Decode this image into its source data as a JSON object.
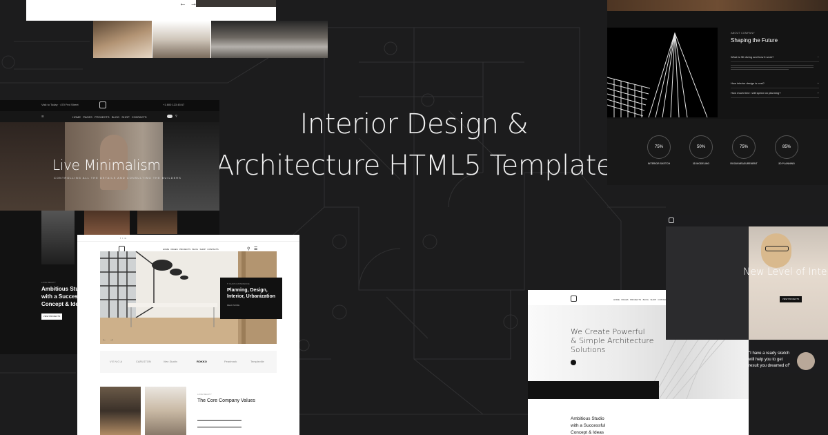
{
  "hero": {
    "line1": "Interior Design &",
    "line2": "Architecture HTML5 Template"
  },
  "left_template": {
    "hero_title": "Live Minimalism",
    "hero_subtitle": "CONTROLLING ALL THE DETAILS AND CONSULTING THE BUILDERS",
    "studio_label": "LOVE BEAUTY",
    "studio_lines": [
      "Ambitious Studio",
      "with a Successful",
      "Concept & Ideas"
    ],
    "button": "VIEW PROJECTS"
  },
  "top_right_template": {
    "label": "ABOUT COMPANY",
    "heading": "Shaping the Future",
    "accordion": [
      "What is 3D diving and how it work?",
      "How interior design is cost?",
      "How much time I will spend on planning?"
    ],
    "stats": [
      {
        "value": "75%",
        "caption": "INTERIOR SKETCH"
      },
      {
        "value": "50%",
        "caption": "3D MODELING"
      },
      {
        "value": "75%",
        "caption": "ROOM MEASUREMENT"
      },
      {
        "value": "85%",
        "caption": "3D PLANNING"
      }
    ]
  },
  "center_template": {
    "overlay_tag": "5 YEARS EXPERIENCE",
    "overlay_text": [
      "Planning, Design,",
      "Interior, Urbanization"
    ],
    "overlay_more": "READ MORE",
    "logos": [
      "VENGA",
      "CARLSTON",
      "Neo Studio",
      "ROKKO",
      "Pearlmark",
      "Templeville"
    ],
    "core_label": "LOVE BEAUTY",
    "core_title": "The Core Company Values"
  },
  "bottom_right_template": {
    "hero_lines": [
      "We Create Powerful",
      "& Simple Architecture",
      "Solutions"
    ],
    "ambition": [
      "Ambitious Studio",
      "with a Successful",
      "Concept & Ideas"
    ]
  },
  "right_woman_template": {
    "title": "New Level of Inter",
    "button": "VIEW PROJECTS",
    "sketch_lines": [
      "\"I have a ready sketch",
      "will help you to get",
      "result you dreamed of\""
    ]
  },
  "colors": {
    "background": "#1c1c1d",
    "panel_dark": "#121212",
    "panel_light": "#ffffff"
  }
}
